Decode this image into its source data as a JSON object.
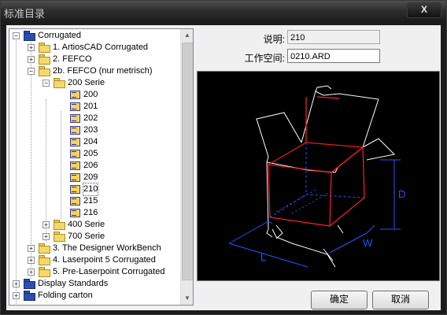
{
  "window": {
    "title": "标准目录",
    "close_label": "X"
  },
  "tree": {
    "items": [
      {
        "label": "Corrugated"
      },
      {
        "label": "1. ArtiosCAD Corrugated"
      },
      {
        "label": "2.  FEFCO"
      },
      {
        "label": "2b. FEFCO (nur metrisch)"
      },
      {
        "label": "200 Serie"
      },
      {
        "label": "200"
      },
      {
        "label": "201"
      },
      {
        "label": "202"
      },
      {
        "label": "203"
      },
      {
        "label": "204"
      },
      {
        "label": "205"
      },
      {
        "label": "206"
      },
      {
        "label": "209"
      },
      {
        "label": "210"
      },
      {
        "label": "215"
      },
      {
        "label": "216"
      },
      {
        "label": "400 Serie"
      },
      {
        "label": "700 Serie"
      },
      {
        "label": "3. The Designer WorkBench"
      },
      {
        "label": "4. Laserpoint 5 Corrugated"
      },
      {
        "label": "5. Pre-Laserpoint Corrugated"
      },
      {
        "label": "Display Standards"
      },
      {
        "label": "Folding carton"
      }
    ],
    "selected": "210"
  },
  "form": {
    "description_label": "说明:",
    "description_value": "210",
    "workspace_label": "工作空间:",
    "workspace_value": "0210.ARD"
  },
  "preview": {
    "dimension_labels": [
      "D",
      "W",
      "L"
    ],
    "colors": {
      "background": "#000000",
      "outline": "#ffffff",
      "panel": "#ff2020",
      "dimension": "#2255ff"
    }
  },
  "buttons": {
    "ok": "确定",
    "cancel": "取消"
  }
}
